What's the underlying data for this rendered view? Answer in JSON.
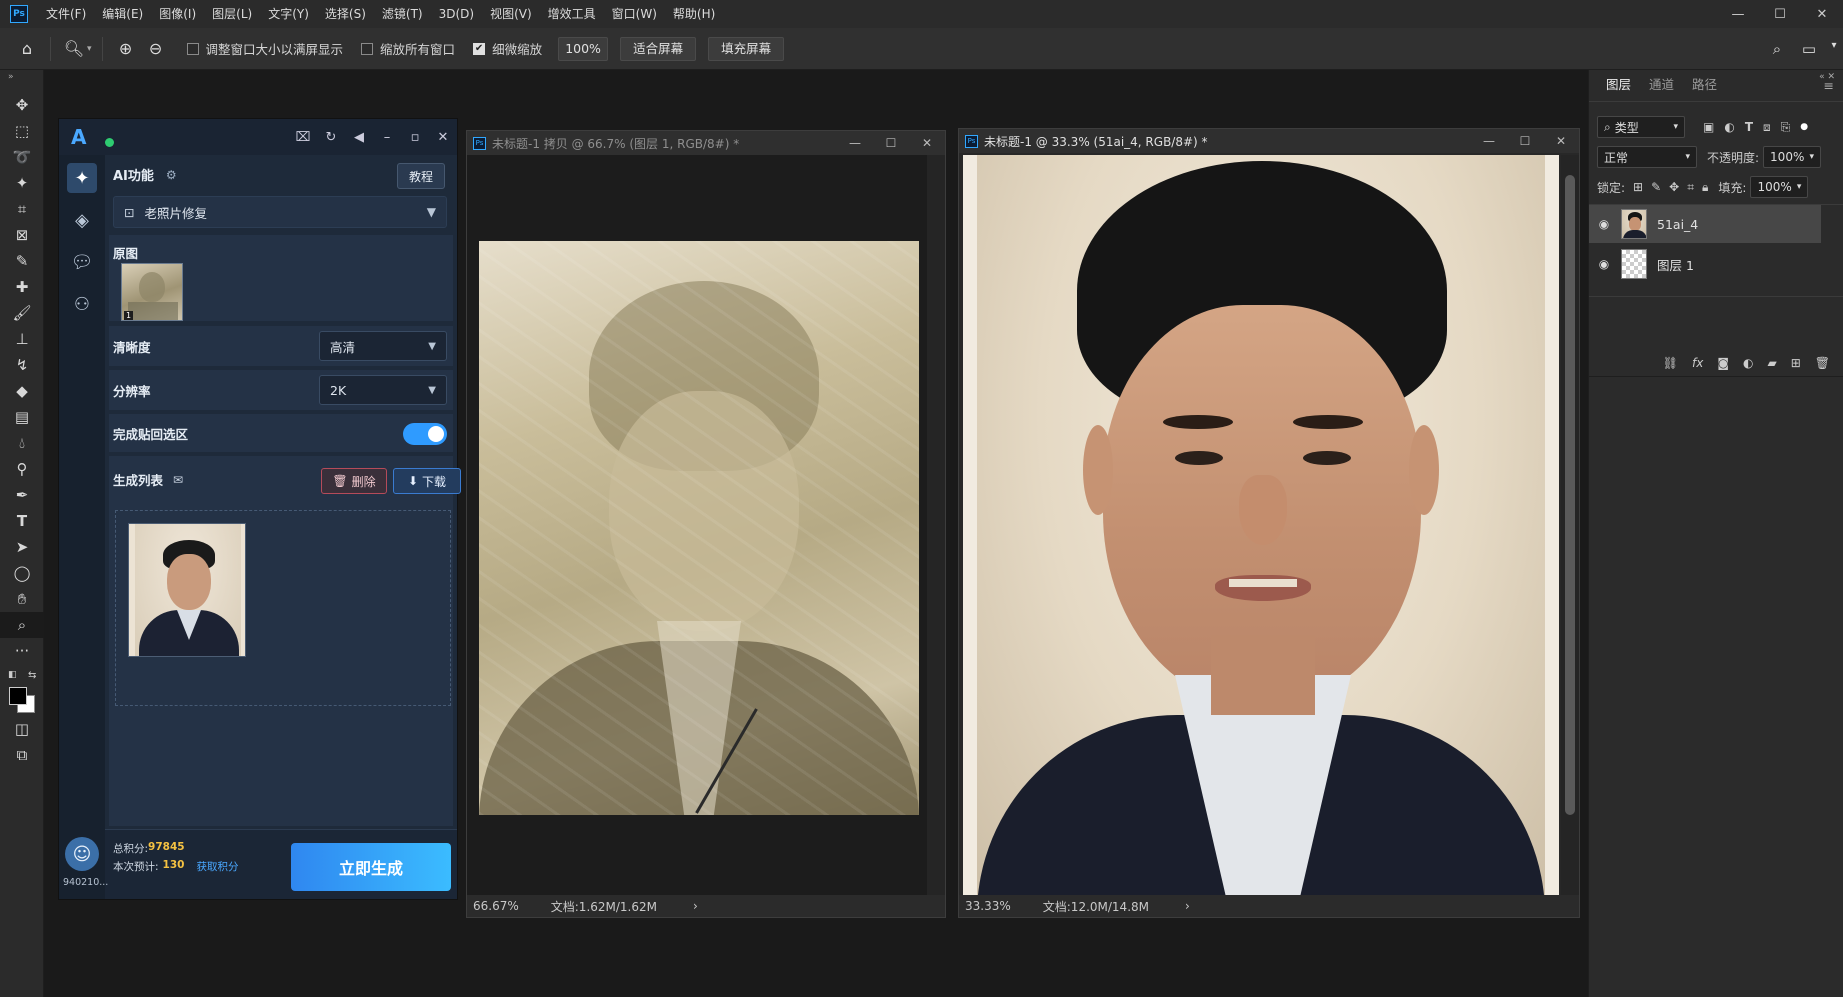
{
  "menubar": {
    "logo": "Ps",
    "items": [
      "文件(F)",
      "编辑(E)",
      "图像(I)",
      "图层(L)",
      "文字(Y)",
      "选择(S)",
      "滤镜(T)",
      "3D(D)",
      "视图(V)",
      "增效工具",
      "窗口(W)",
      "帮助(H)"
    ],
    "controls": [
      "—",
      "☐",
      "✕"
    ]
  },
  "optbar": {
    "resize_windows": "调整窗口大小以满屏显示",
    "zoom_all": "缩放所有窗口",
    "scrubby_zoom": "细微缩放",
    "zoom_value": "100%",
    "fit_screen": "适合屏幕",
    "fill_screen": "填充屏幕"
  },
  "plugin": {
    "ai_label": "AI功能",
    "tutorial": "教程",
    "function_value": "老照片修复",
    "original_label": "原图",
    "original_badge": "1",
    "clarity_label": "清晰度",
    "clarity_value": "高清",
    "resolution_label": "分辨率",
    "resolution_value": "2K",
    "paste_label": "完成贴回选区",
    "paste_on": true,
    "gen_list_label": "生成列表",
    "delete": "删除",
    "download": "下载",
    "total_label": "总积分:",
    "total_value": "97845",
    "estimate_label": "本次预计:",
    "estimate_value": "130",
    "get_points": "获取积分",
    "user_id": "940210...",
    "generate": "立即生成",
    "accent": "#2f9bff",
    "points_color": "#f5c242"
  },
  "doc1": {
    "title": "未标题-1 拷贝 @ 66.7% (图层 1, RGB/8#) *",
    "zoom": "66.67%",
    "info": "文档:1.62M/1.62M",
    "chev": "›"
  },
  "doc2": {
    "title": "未标题-1 @ 33.3% (51ai_4, RGB/8#) *",
    "zoom": "33.33%",
    "info": "文档:12.0M/14.8M",
    "chev": "›"
  },
  "layers": {
    "tabs": [
      "图层",
      "通道",
      "路径"
    ],
    "filter_kind": "类型",
    "blend_mode": "正常",
    "opacity_label": "不透明度:",
    "opacity_value": "100%",
    "lock_label": "锁定:",
    "fill_label": "填充:",
    "fill_value": "100%",
    "items": [
      {
        "name": "51ai_4",
        "selected": true
      },
      {
        "name": "图层 1",
        "selected": false
      }
    ]
  }
}
